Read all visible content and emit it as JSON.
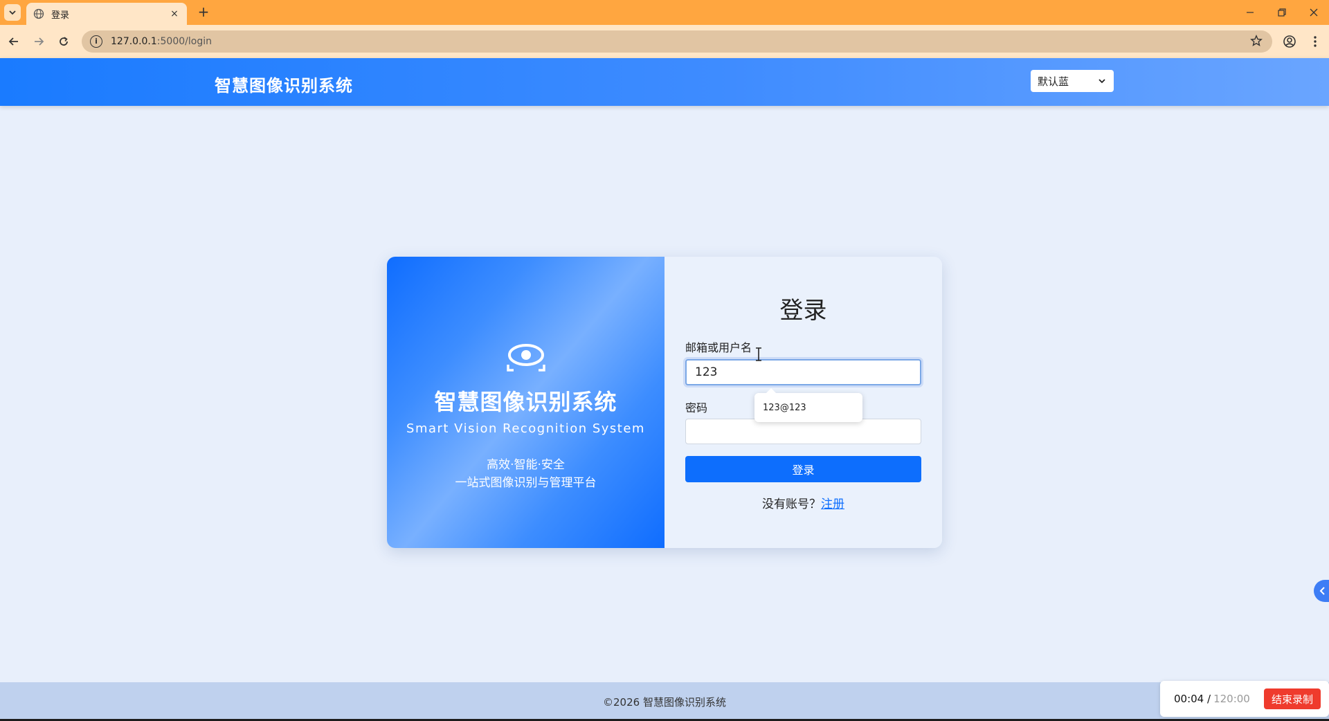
{
  "browser": {
    "tab_title": "登录",
    "tab_close": "×",
    "new_tab": "+",
    "url_host": "127.0.0.1",
    "url_path": ":5000/login"
  },
  "header": {
    "brand": "智慧图像识别系统",
    "theme_selected": "默认蓝"
  },
  "hero": {
    "title": "智慧图像识别系统",
    "subtitle": "Smart Vision Recognition System",
    "tagline1": "高效·智能·安全",
    "tagline2": "一站式图像识别与管理平台"
  },
  "form": {
    "title": "登录",
    "username_label": "邮箱或用户名",
    "username_value": "123",
    "password_label": "密码",
    "password_value": "",
    "submit_label": "登录",
    "register_prompt": "没有账号？",
    "register_link": "注册"
  },
  "autocomplete": {
    "suggestion": "123@123"
  },
  "footer": {
    "copyright": "©2026 智慧图像识别系统"
  },
  "recorder": {
    "elapsed": "00:04 /",
    "total": "120:00",
    "stop_label": "结束录制"
  }
}
